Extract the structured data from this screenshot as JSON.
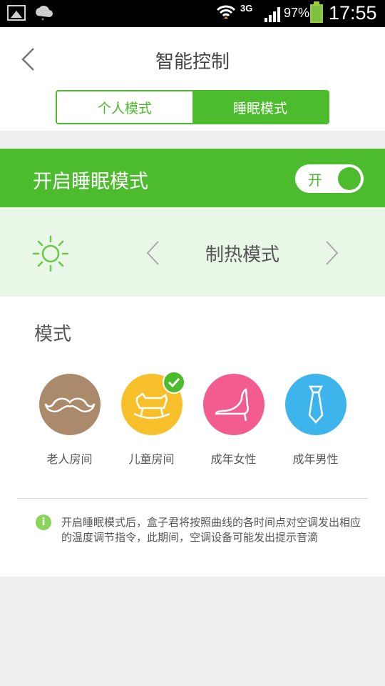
{
  "status_bar": {
    "network": "3G",
    "battery": "97%",
    "time": "17:55"
  },
  "header": {
    "title": "智能控制",
    "tabs": [
      "个人模式",
      "睡眠模式"
    ],
    "active_tab": 1
  },
  "sleep_mode": {
    "label": "开启睡眠模式",
    "toggle_text": "开",
    "enabled": true
  },
  "ac_mode": {
    "name": "制热模式",
    "icon": "sun-icon"
  },
  "modes": {
    "title": "模式",
    "items": [
      {
        "label": "老人房间",
        "icon": "mustache-icon",
        "color": "#ab8a6c",
        "selected": false
      },
      {
        "label": "儿童房间",
        "icon": "rocking-horse-icon",
        "color": "#f7c02b",
        "selected": true
      },
      {
        "label": "成年女性",
        "icon": "high-heel-icon",
        "color": "#f25c8e",
        "selected": false
      },
      {
        "label": "成年男性",
        "icon": "necktie-icon",
        "color": "#3db5ec",
        "selected": false
      }
    ]
  },
  "info": {
    "icon": "info-icon",
    "text": "开启睡眠模式后，盒子君将按照曲线的各时间点对空调发出相应的温度调节指令，此期间，空调设备可能发出提示音滴"
  },
  "colors": {
    "accent": "#4cbb2e",
    "panel": "#e9f7e7"
  }
}
